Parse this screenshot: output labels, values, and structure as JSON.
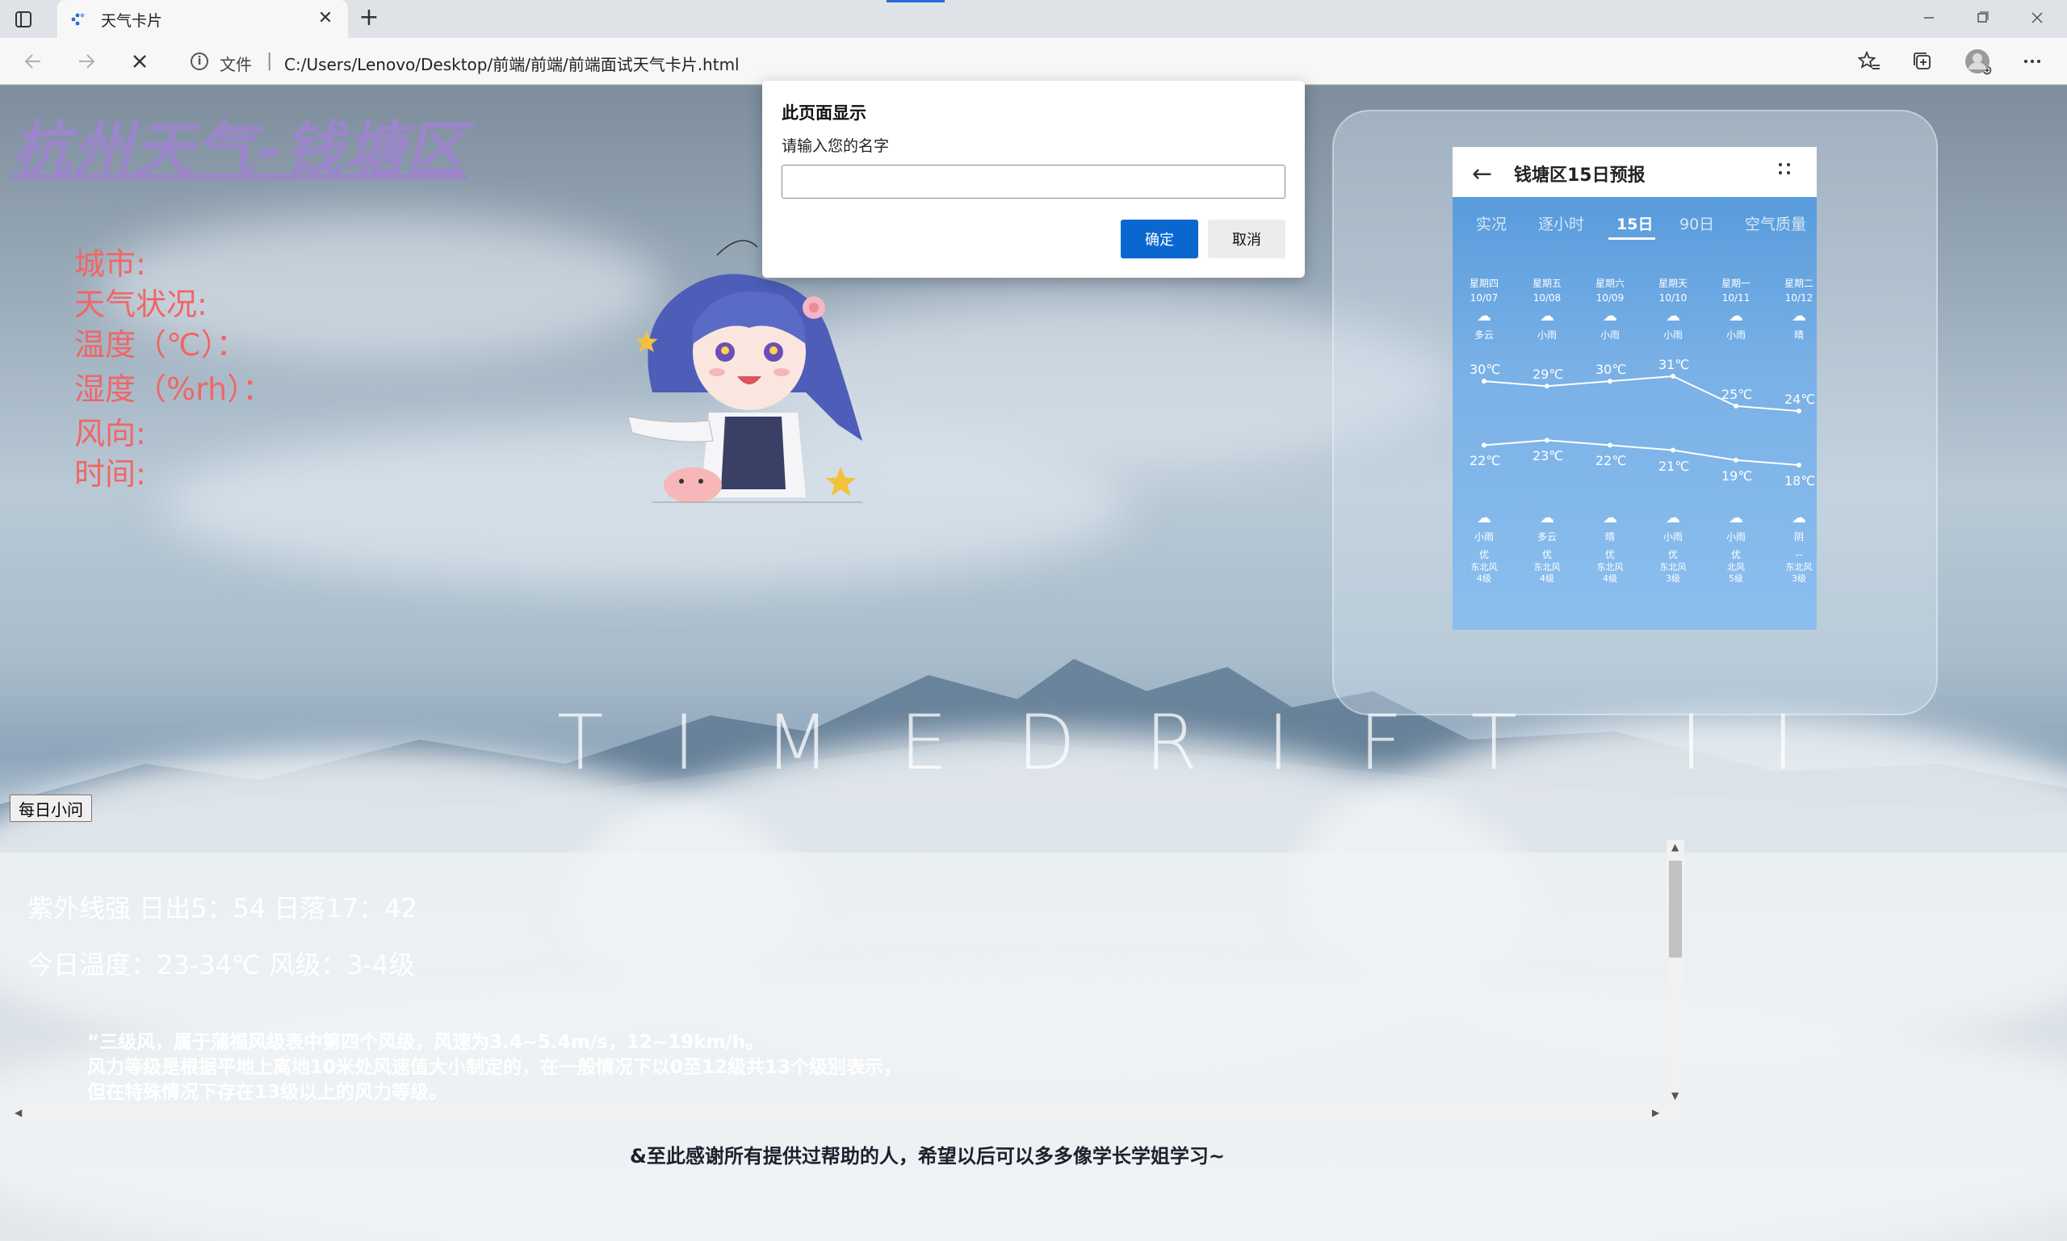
{
  "browser": {
    "tab_title": "天气卡片",
    "address_label": "文件",
    "address_separator": "|",
    "url": "C:/Users/Lenovo/Desktop/前端/前端/前端面试天气卡片.html",
    "new_tab_symbol": "+",
    "close_tab_symbol": "✕"
  },
  "page": {
    "title": "杭州天气-钱塘区",
    "info_rows": [
      "城市:",
      "天气状况:",
      "温度（℃）：",
      "湿度（%rh）：",
      "风向:",
      "时间:"
    ],
    "watermark": "TIMEDRIFT II",
    "question_button": "每日小问",
    "info_line1": "紫外线强 日出5：54 日落17：42",
    "info_line2": "今日温度：23-34℃ 风级：3-4级",
    "note_lines": [
      "“三级风，属于蒲福风级表中第四个风级，风速为3.4~5.4m/s，12~19km/h。",
      "风力等级是根据平地上离地10米处风速值大小制定的，在一般情况下以0至12级共13个级别表示，",
      "但在特殊情况下存在13级以上的风力等级。"
    ],
    "thanks": "&至此感谢所有提供过帮助的人，希望以后可以多多像学长学姐学习~"
  },
  "forecast": {
    "title": "钱塘区15日预报",
    "tabs": [
      "实况",
      "逐小时",
      "15日",
      "90日",
      "空气质量"
    ],
    "active_tab": "15日",
    "days": [
      {
        "week": "星期四",
        "date": "10/07",
        "day_weather": "多云",
        "high": "30℃",
        "low": "22℃",
        "night_weather": "小雨",
        "aqi": "优",
        "wind": "东北风",
        "level": "4级"
      },
      {
        "week": "星期五",
        "date": "10/08",
        "day_weather": "小雨",
        "high": "29℃",
        "low": "23℃",
        "night_weather": "多云",
        "aqi": "优",
        "wind": "东北风",
        "level": "4级"
      },
      {
        "week": "星期六",
        "date": "10/09",
        "day_weather": "小雨",
        "high": "30℃",
        "low": "22℃",
        "night_weather": "晴",
        "aqi": "优",
        "wind": "东北风",
        "level": "4级"
      },
      {
        "week": "星期天",
        "date": "10/10",
        "day_weather": "小雨",
        "high": "31℃",
        "low": "21℃",
        "night_weather": "小雨",
        "aqi": "优",
        "wind": "东北风",
        "level": "3级"
      },
      {
        "week": "星期一",
        "date": "10/11",
        "day_weather": "小雨",
        "high": "25℃",
        "low": "19℃",
        "night_weather": "小雨",
        "aqi": "优",
        "wind": "北风",
        "level": "5级"
      },
      {
        "week": "星期二",
        "date": "10/12",
        "day_weather": "晴",
        "high": "24℃",
        "low": "18℃",
        "night_weather": "阴",
        "aqi": "--",
        "wind": "东北风",
        "level": "3级"
      }
    ]
  },
  "dialog": {
    "title": "此页面显示",
    "message": "请输入您的名字",
    "input_value": "",
    "ok_label": "确定",
    "cancel_label": "取消"
  },
  "colors": {
    "accent": "#0a67d0",
    "title_purple": "#9a86c9",
    "info_red": "#f06666"
  }
}
